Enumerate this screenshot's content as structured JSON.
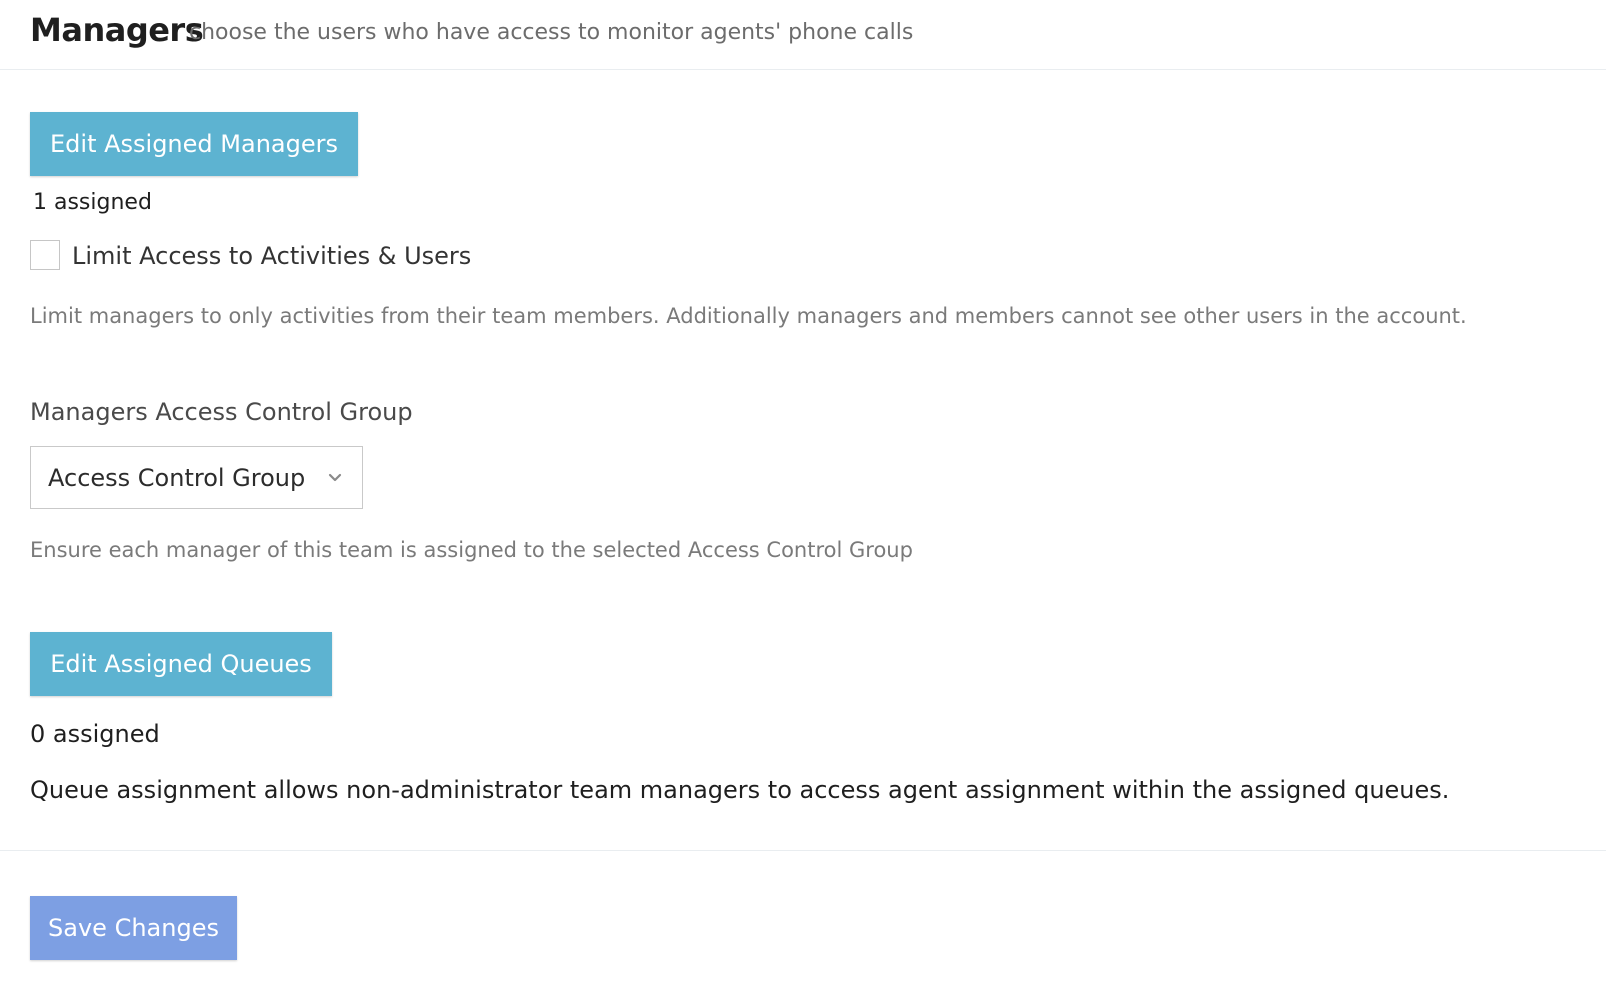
{
  "header": {
    "title": "Managers",
    "subtitle": "choose the users who have access to monitor agents' phone calls"
  },
  "managers": {
    "edit_button_label": "Edit Assigned Managers",
    "assigned_count_text": "1 assigned",
    "limit_access_checkbox": {
      "label": "Limit Access to Activities & Users",
      "checked": false
    },
    "limit_access_help": "Limit managers to only activities from their team members. Additionally managers and members cannot see other users in the account."
  },
  "access_control": {
    "label": "Managers Access Control Group",
    "select_value": "Access Control Group",
    "help": "Ensure each manager of this team is assigned to the selected Access Control Group"
  },
  "queues": {
    "edit_button_label": "Edit Assigned Queues",
    "assigned_count_text": "0 assigned",
    "description": "Queue assignment allows non-administrator team managers to access agent assignment within the assigned queues."
  },
  "footer": {
    "save_button_label": "Save Changes"
  },
  "colors": {
    "teal_button": "#5db3d1",
    "save_button": "#7d9fe3"
  },
  "icons": {
    "select_chevron": "chevron-down-icon"
  }
}
